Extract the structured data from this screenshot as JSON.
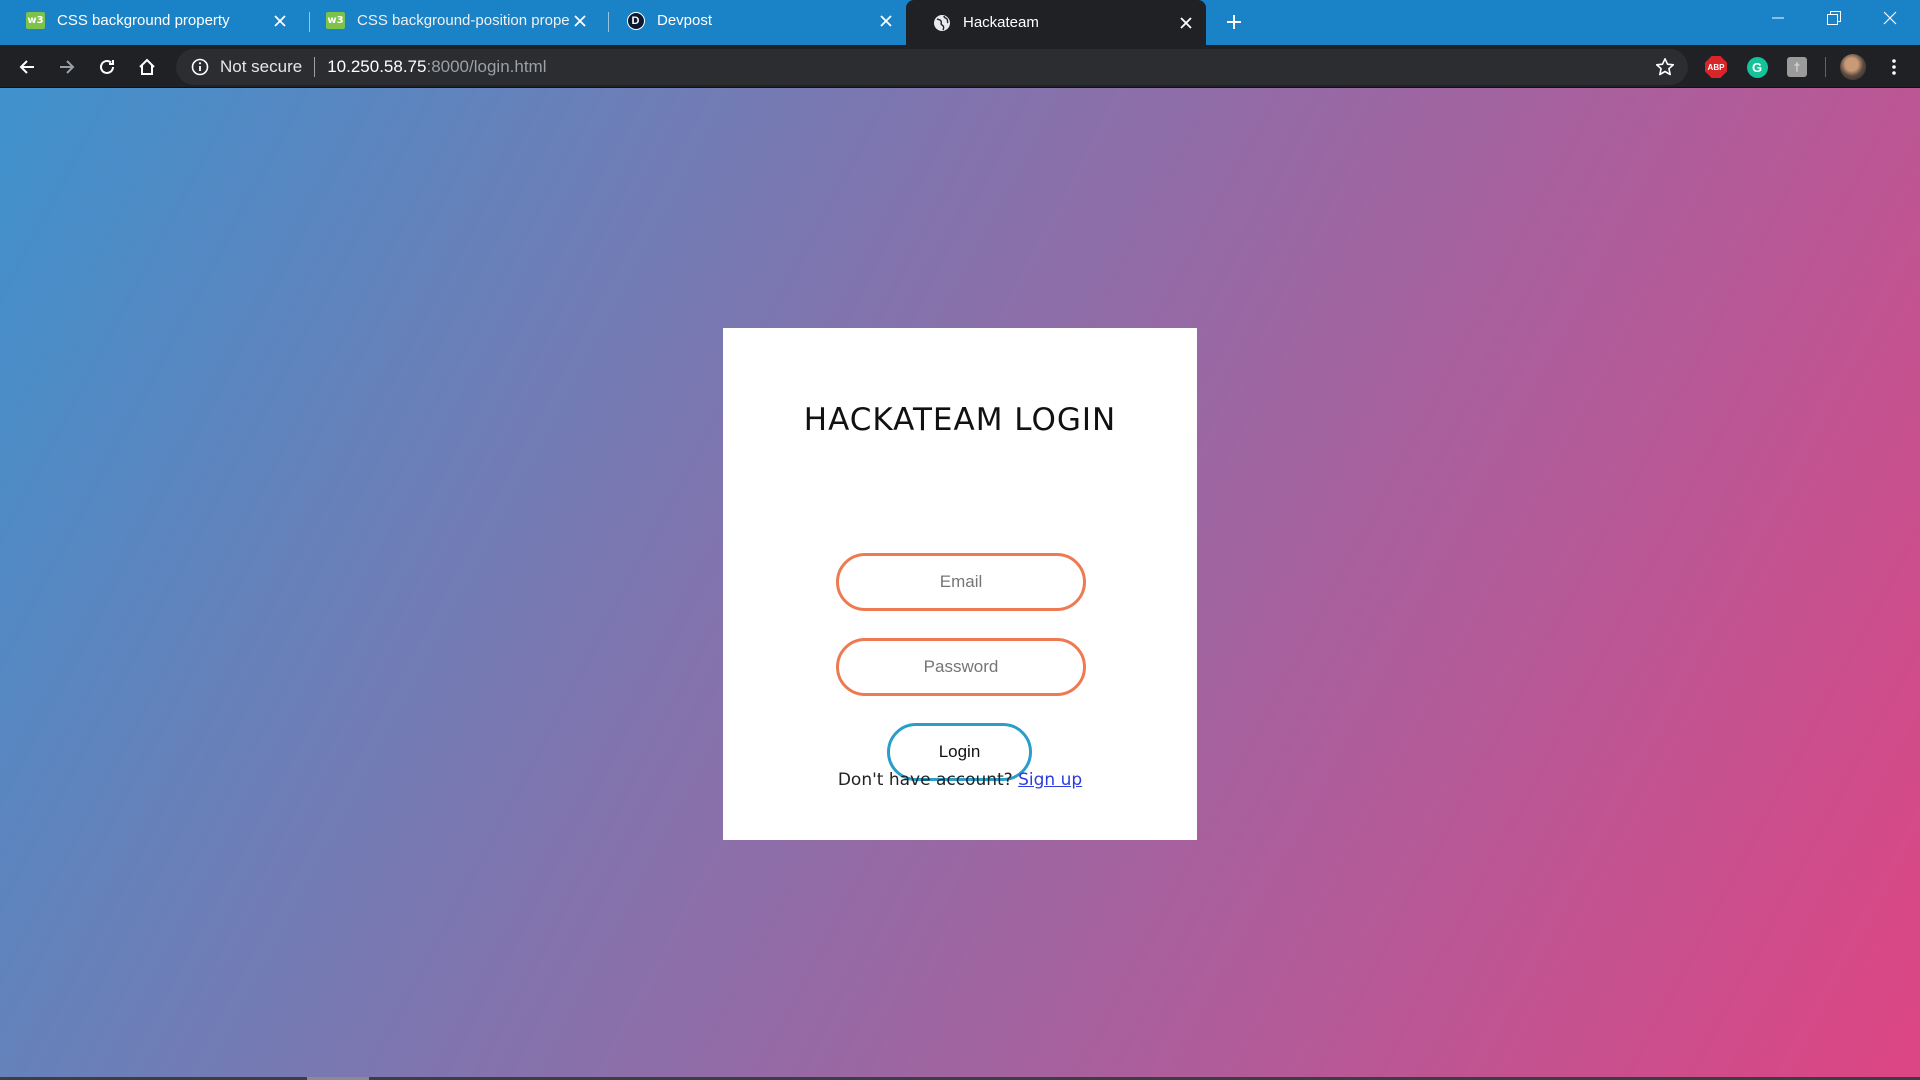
{
  "browser": {
    "tabs": [
      {
        "title": "CSS background property",
        "favicon": "w3schools-icon",
        "favicon_text": "w3"
      },
      {
        "title": "CSS background-position proper",
        "favicon": "w3schools-icon",
        "favicon_text": "w3"
      },
      {
        "title": "Devpost",
        "favicon": "devpost-icon",
        "favicon_text": "D"
      },
      {
        "title": "Hackateam",
        "favicon": "globe-icon",
        "active": true
      }
    ],
    "omnibox": {
      "security_label": "Not secure",
      "url_host": "10.250.58.75",
      "url_path": ":8000/login.html"
    },
    "extensions": {
      "abp_label": "ABP",
      "grammarly_label": "G",
      "gray_ext_label": "†"
    }
  },
  "page": {
    "title": "HACKATEAM LOGIN",
    "email": {
      "placeholder": "Email",
      "value": ""
    },
    "password": {
      "placeholder": "Password",
      "value": ""
    },
    "login_label": "Login",
    "signup_prompt": "Don't have account?",
    "signup_link": "Sign up"
  },
  "colors": {
    "tabstrip": "#1a82c6",
    "toolbar": "#1f2125",
    "input_border": "#ee7a52",
    "button_border": "#2a9dc9",
    "link": "#2b3ce0",
    "gradient_start": "#3f92cd",
    "gradient_end": "#de4583"
  }
}
